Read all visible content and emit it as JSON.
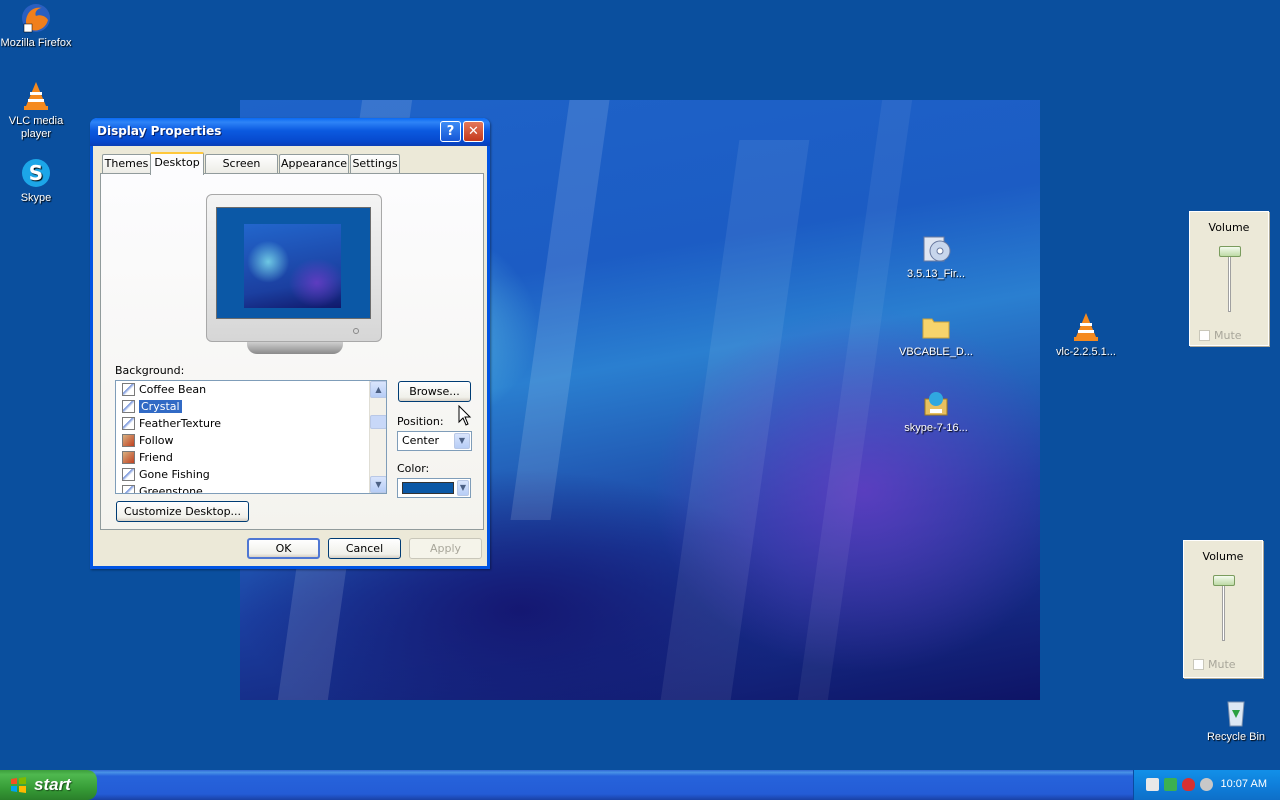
{
  "desktop": {
    "icons": [
      {
        "label": "Mozilla Firefox",
        "icon": "firefox-icon"
      },
      {
        "label": "VLC media player",
        "icon": "vlc-icon"
      },
      {
        "label": "Skype",
        "icon": "skype-icon"
      },
      {
        "label": "3.5.13_Fir...",
        "icon": "installer-disc-icon"
      },
      {
        "label": "VBCABLE_D...",
        "icon": "folder-icon"
      },
      {
        "label": "skype-7-16...",
        "icon": "setup-package-icon"
      },
      {
        "label": "vlc-2.2.5.1...",
        "icon": "vlc-icon"
      },
      {
        "label": "Recycle Bin",
        "icon": "recycle-bin-icon"
      }
    ]
  },
  "dialog": {
    "title": "Display Properties",
    "help_button": "?",
    "close_button": "✕",
    "tabs": [
      "Themes",
      "Desktop",
      "Screen Saver",
      "Appearance",
      "Settings"
    ],
    "active_tab": "Desktop",
    "background_label": "Background:",
    "background_items": [
      "Coffee Bean",
      "Crystal",
      "FeatherTexture",
      "Follow",
      "Friend",
      "Gone Fishing",
      "Greenstone"
    ],
    "selected_background": "Crystal",
    "browse_button": "Browse...",
    "position_label": "Position:",
    "position_value": "Center",
    "color_label": "Color:",
    "color_value": "#0b58a6",
    "customize_button": "Customize Desktop...",
    "ok_button": "OK",
    "cancel_button": "Cancel",
    "apply_button": "Apply"
  },
  "volume_panels": [
    {
      "title": "Volume",
      "mute_label": "Mute"
    },
    {
      "title": "Volume",
      "mute_label": "Mute"
    }
  ],
  "taskbar": {
    "start_label": "start",
    "clock": "10:07 AM"
  }
}
